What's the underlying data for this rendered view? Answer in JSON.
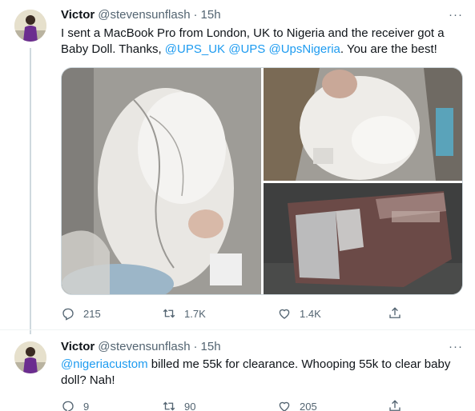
{
  "tweets": [
    {
      "name": "Victor",
      "handle": "@stevensunflash",
      "separator": "·",
      "time": "15h",
      "text_parts": [
        {
          "text": "I sent a MacBook Pro from London, UK to Nigeria and the receiver got a Baby Doll. Thanks, ",
          "mention": false
        },
        {
          "text": "@UPS_UK",
          "mention": true
        },
        {
          "text": " ",
          "mention": false
        },
        {
          "text": "@UPS",
          "mention": true
        },
        {
          "text": " ",
          "mention": false
        },
        {
          "text": "@UpsNigeria",
          "mention": true
        },
        {
          "text": ". You are the best!",
          "mention": false
        }
      ],
      "media": [
        {
          "alt_icon": "baby-doll-in-bubble-wrap-photo"
        },
        {
          "alt_icon": "baby-doll-closeup-photo"
        },
        {
          "alt_icon": "torn-package-photo"
        }
      ],
      "replies": "215",
      "retweets": "1.7K",
      "likes": "1.4K"
    },
    {
      "name": "Victor",
      "handle": "@stevensunflash",
      "separator": "·",
      "time": "15h",
      "text_parts": [
        {
          "text": "@nigeriacustom",
          "mention": true
        },
        {
          "text": " billed me 55k for clearance. Whooping 55k to clear baby doll? Nah!",
          "mention": false
        }
      ],
      "replies": "9",
      "retweets": "90",
      "likes": "205"
    }
  ],
  "more_glyph": "···",
  "colors": {
    "accent": "#1d9bf0",
    "text": "#0f1419",
    "secondary": "#536471",
    "border": "#cfd9de"
  }
}
